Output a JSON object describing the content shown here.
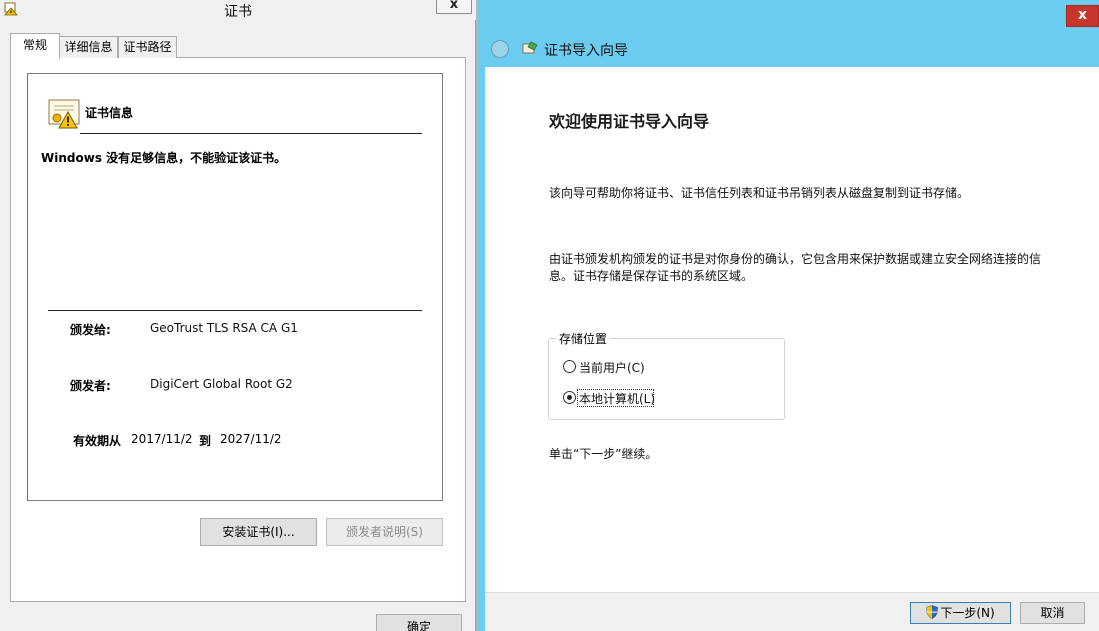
{
  "cert_window": {
    "title": "证书",
    "close_label": "x",
    "tabs": [
      {
        "label": "常规"
      },
      {
        "label": "详细信息"
      },
      {
        "label": "证书路径"
      }
    ],
    "info_heading": "证书信息",
    "warning": "Windows 没有足够信息，不能验证该证书。",
    "issued_to_label": "颁发给:",
    "issued_to": "GeoTrust TLS RSA CA G1",
    "issued_by_label": "颁发者:",
    "issued_by": "DigiCert Global Root G2",
    "valid_label": "有效期从",
    "valid_from": "2017/11/2",
    "valid_to_label": "到",
    "valid_to": "2027/11/2",
    "install_button": "安装证书(I)...",
    "issuer_statement_button": "颁发者说明(S)",
    "ok_button": "确定"
  },
  "wizard": {
    "title": "证书导入向导",
    "close_label": "x",
    "heading": "欢迎使用证书导入向导",
    "intro": "该向导可帮助你将证书、证书信任列表和证书吊销列表从磁盘复制到证书存储。",
    "desc_line1": "由证书颁发机构颁发的证书是对你身份的确认，它包含用来保护数据或建立安全网络连接的信",
    "desc_line2": "息。证书存储是保存证书的系统区域。",
    "store_group_label": "存储位置",
    "store_options": [
      {
        "label": "当前用户(C)",
        "selected": false
      },
      {
        "label": "本地计算机(L)",
        "selected": true
      }
    ],
    "continue_hint": "单击“下一步”继续。",
    "next_button": "下一步(N)",
    "cancel_button": "取消"
  },
  "colors": {
    "wizard_chrome": "#6bcbf0",
    "close_red": "#c8352c"
  }
}
